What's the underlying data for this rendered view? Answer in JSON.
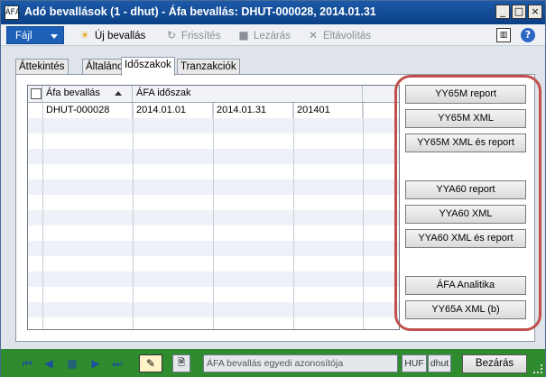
{
  "window": {
    "title": "Adó bevallások (1 - dhut) - Áfa bevallás: DHUT-000028, 2014.01.31",
    "app_icon": "ÁFA",
    "minimize_icon": "_",
    "maximize_icon": "□",
    "close_icon": "×"
  },
  "toolbar": {
    "file_label": "Fájl",
    "new_label": "Új bevallás",
    "new_icon": "☀",
    "refresh_label": "Frissítés",
    "refresh_icon": "↻",
    "post_label": "Lezárás",
    "post_icon": "■",
    "remove_label": "Eltávolítás",
    "remove_icon": "✕",
    "layout_icon": "▥",
    "help_icon": "?"
  },
  "tabs": [
    "Áttekintés",
    "Általános",
    "Időszakok",
    "Tranzakciók"
  ],
  "active_tab": "Időszakok",
  "grid": {
    "headers": [
      "Áfa bevallás",
      "ÁFA időszak"
    ],
    "rows": [
      [
        "DHUT-000028",
        "2014.01.01",
        "2014.01.31",
        "201401"
      ]
    ]
  },
  "actions": [
    "YY65M report",
    "YY65M XML",
    "YY65M XML és report",
    "YYA60 report",
    "YYA60 XML",
    "YYA60 XML és report",
    "ÁFA Analitika",
    "YY65A XML (b)"
  ],
  "statusbar": {
    "nav_first": "⏮",
    "nav_prev": "◀",
    "nav_grid": "▦",
    "nav_next": "▶",
    "nav_last": "⏭",
    "edit_icon": "✎",
    "note_icon": "🗎",
    "description": "ÁFA bevallás egyedi azonosítója",
    "currency": "HUF",
    "company": "dhut",
    "close_label": "Bezárás"
  },
  "colors": {
    "title_bar": "#0b3f86",
    "status_bar": "#2e8b2e",
    "highlight_ring": "#c0504d"
  }
}
